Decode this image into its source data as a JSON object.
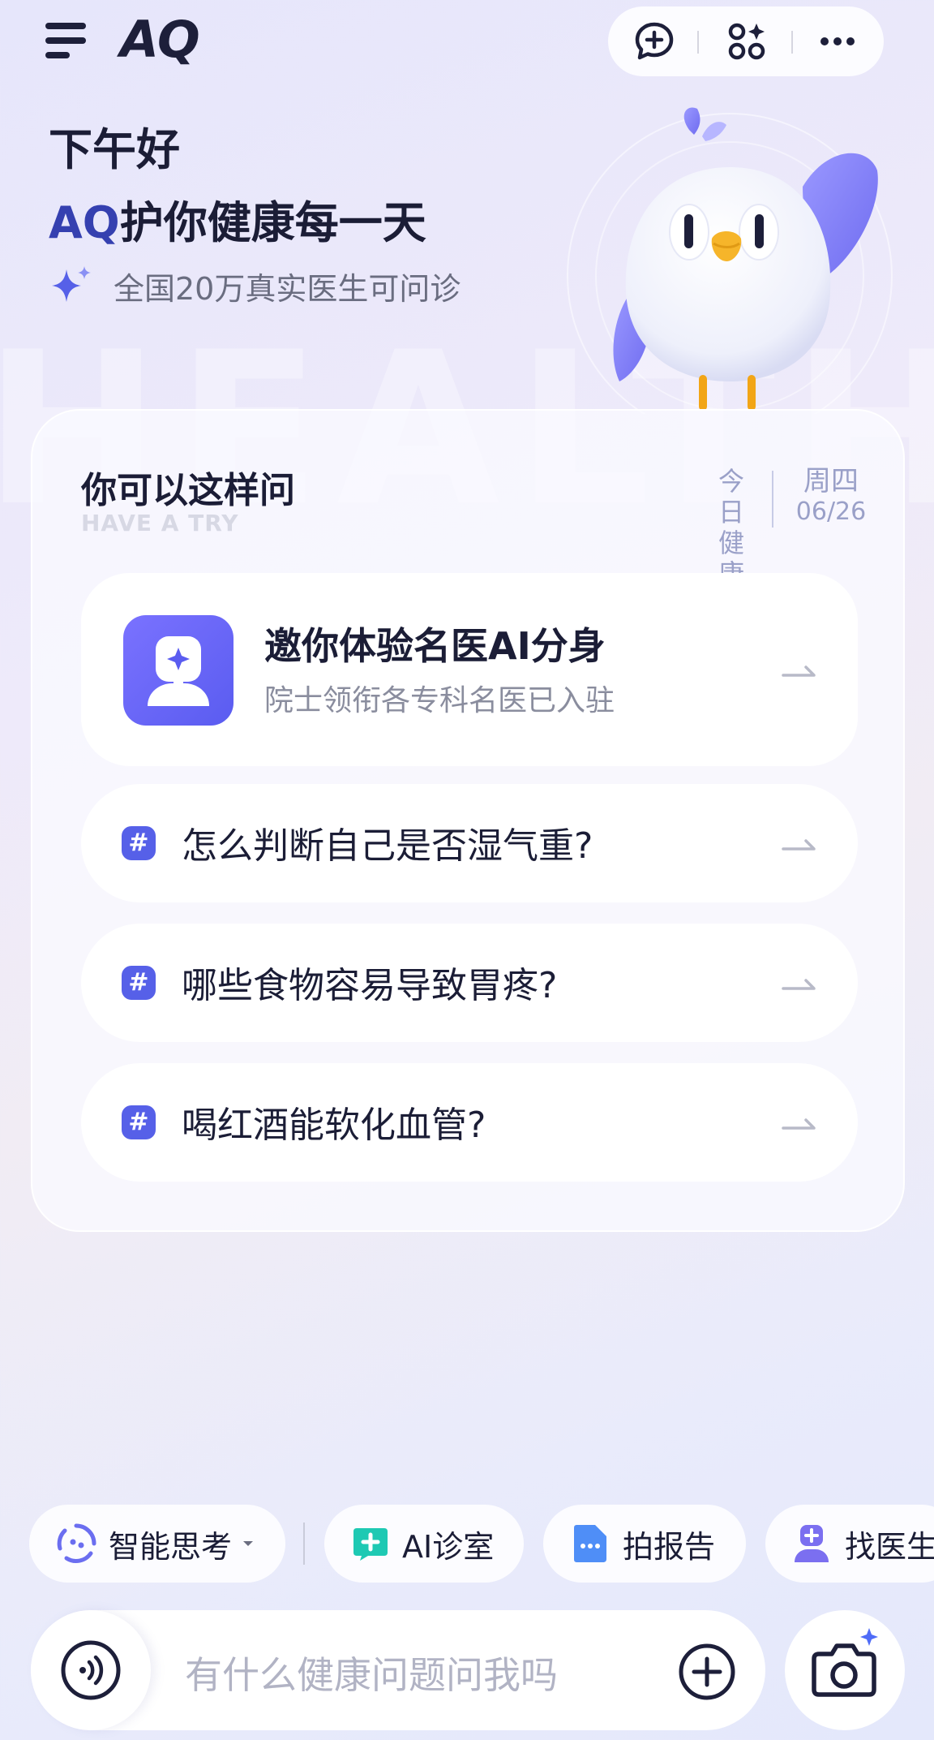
{
  "header": {
    "logo": "AQ",
    "icons": [
      "menu-icon",
      "new-chat-icon",
      "apps-icon",
      "more-icon"
    ]
  },
  "greeting": {
    "line1": "下午好",
    "line2_brand": "AQ",
    "line2_rest": "护你健康每一天",
    "subline": "全国20万真实医生可问诊"
  },
  "watermark": "HEALTH",
  "card": {
    "title": "你可以这样问",
    "subtitle": "HAVE A TRY",
    "today_label": "今日健康",
    "today_line1": "今日",
    "today_line2": "健康",
    "weekday": "周四",
    "date": "06/26",
    "feature": {
      "title": "邀你体验名医AI分身",
      "subtitle": "院士领衔各专科名医已入驻"
    },
    "questions": [
      {
        "hash": "#",
        "text": "怎么判断自己是否湿气重?"
      },
      {
        "hash": "#",
        "text": "哪些食物容易导致胃疼?"
      },
      {
        "hash": "#",
        "text": "喝红酒能软化血管?"
      }
    ]
  },
  "toolbar": {
    "chips": [
      {
        "label": "智能思考",
        "icon": "thinking-icon"
      },
      {
        "label": "AI诊室",
        "icon": "clinic-icon"
      },
      {
        "label": "拍报告",
        "icon": "report-icon"
      },
      {
        "label": "找医生",
        "icon": "doctor-icon"
      }
    ]
  },
  "input": {
    "placeholder": "有什么健康问题问我吗"
  },
  "colors": {
    "brand": "#3540b0",
    "accent": "#5660e8",
    "text": "#1b1d36",
    "muted": "#8a8d9e"
  }
}
